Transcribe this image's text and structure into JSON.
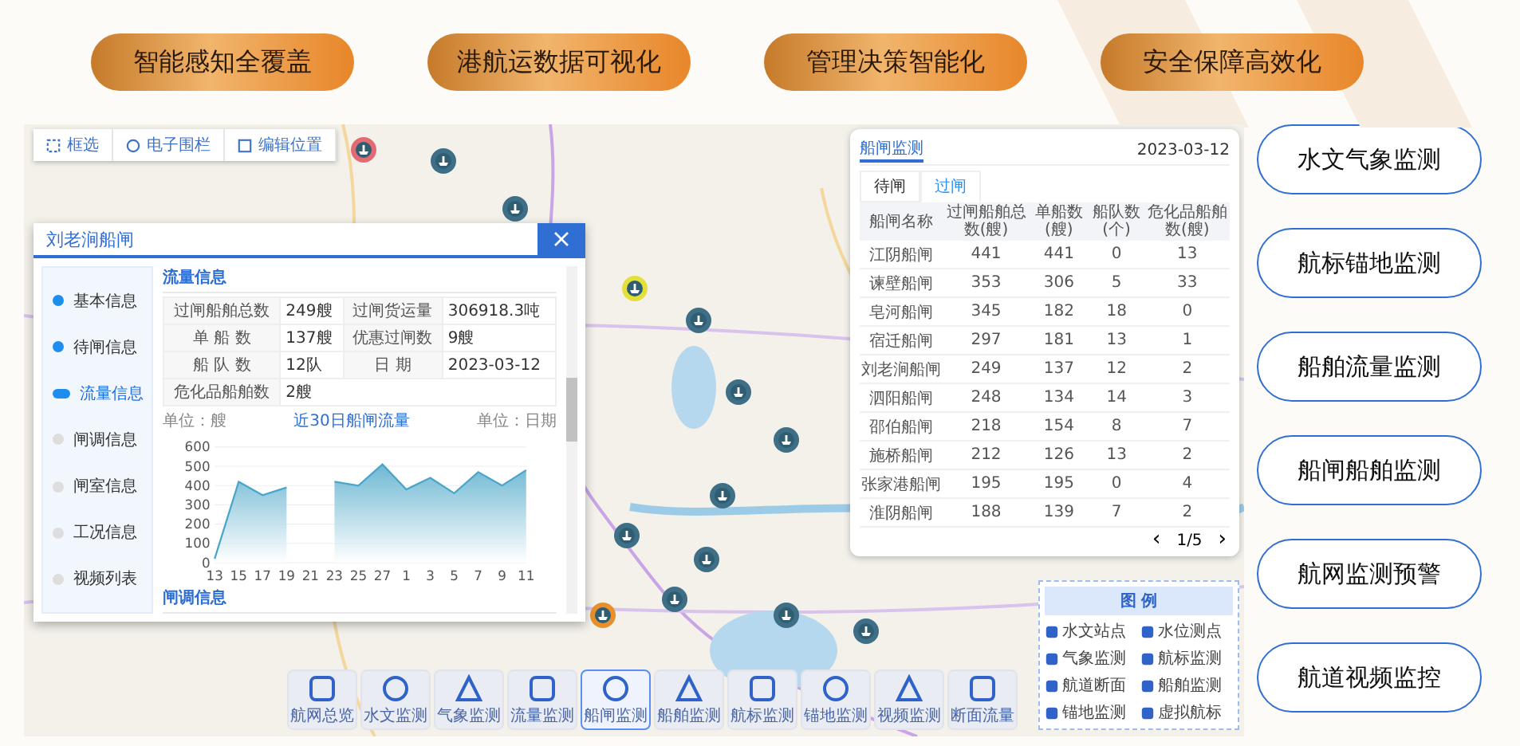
{
  "banner_pills": [
    "智能感知全覆盖",
    "港航运数据可视化",
    "管理决策智能化",
    "安全保障高效化"
  ],
  "map": {
    "tools": [
      "框选",
      "电子围栏",
      "编辑位置"
    ],
    "lock_popup": {
      "title": "刘老涧船闸",
      "steps": [
        {
          "label": "基本信息",
          "done": true,
          "selected": false
        },
        {
          "label": "待闸信息",
          "done": true,
          "selected": false
        },
        {
          "label": "流量信息",
          "done": true,
          "selected": true
        },
        {
          "label": "闸调信息",
          "done": false,
          "selected": false
        },
        {
          "label": "闸室信息",
          "done": false,
          "selected": false
        },
        {
          "label": "工况信息",
          "done": false,
          "selected": false
        },
        {
          "label": "视频列表",
          "done": false,
          "selected": false
        }
      ],
      "section_title": "流量信息",
      "info": [
        [
          {
            "label": "过闸船舶总数",
            "value": "249艘"
          },
          {
            "label": "过闸货运量",
            "value": "306918.3吨"
          }
        ],
        [
          {
            "label": "单 船 数",
            "value": "137艘"
          },
          {
            "label": "优惠过闸数",
            "value": "9艘"
          }
        ],
        [
          {
            "label": "船 队 数",
            "value": "12队"
          },
          {
            "label": "日 期",
            "value": "2023-03-12"
          }
        ],
        [
          {
            "label": "危化品船舶数",
            "value": "2艘"
          }
        ]
      ],
      "flow_chart": {
        "unit_left": "单位：艘",
        "unit_right": "单位：日期",
        "chart_data": {
          "type": "area",
          "title": "近30日船闸流量",
          "categories": [
            "13",
            "15",
            "17",
            "19",
            "21",
            "23",
            "25",
            "27",
            "1",
            "3",
            "5",
            "7",
            "9",
            "11"
          ],
          "series": [
            {
              "color": "#4aa6c8",
              "values": [
                20,
                420,
                350,
                390,
                null,
                420,
                400,
                510,
                380,
                440,
                360,
                470,
                400,
                480
              ]
            }
          ],
          "ylim": [
            0,
            600
          ],
          "yticks": [
            0,
            100,
            200,
            300,
            400,
            500,
            600
          ],
          "grid": true
        }
      },
      "next_section_title": "闸调信息"
    },
    "monitor_panel": {
      "title": "船闸监测",
      "date": "2023-03-12",
      "tabs": [
        {
          "label": "待闸",
          "selected": false
        },
        {
          "label": "过闸",
          "selected": true
        }
      ],
      "columns": [
        "船闸名称",
        "过闸船舶总数(艘)",
        "单船数(艘)",
        "船队数(个)",
        "危化品船舶数(艘)"
      ],
      "rows": [
        [
          "江阴船闸",
          "441",
          "441",
          "0",
          "13"
        ],
        [
          "谏壁船闸",
          "353",
          "306",
          "5",
          "33"
        ],
        [
          "皂河船闸",
          "345",
          "182",
          "18",
          "0"
        ],
        [
          "宿迁船闸",
          "297",
          "181",
          "13",
          "1"
        ],
        [
          "刘老涧船闸",
          "249",
          "137",
          "12",
          "2"
        ],
        [
          "泗阳船闸",
          "248",
          "134",
          "14",
          "3"
        ],
        [
          "邵伯船闸",
          "218",
          "154",
          "8",
          "7"
        ],
        [
          "施桥船闸",
          "212",
          "126",
          "13",
          "2"
        ],
        [
          "张家港船闸",
          "195",
          "195",
          "0",
          "4"
        ],
        [
          "淮阴船闸",
          "188",
          "139",
          "7",
          "2"
        ]
      ],
      "pager": {
        "prev": "‹",
        "page": "1/5",
        "next": "›"
      }
    },
    "toolbar": [
      {
        "label": "航网总览",
        "selected": false
      },
      {
        "label": "水文监测",
        "selected": false
      },
      {
        "label": "气象监测",
        "selected": false
      },
      {
        "label": "流量监测",
        "selected": false
      },
      {
        "label": "船闸监测",
        "selected": true
      },
      {
        "label": "船舶监测",
        "selected": false
      },
      {
        "label": "航标监测",
        "selected": false
      },
      {
        "label": "锚地监测",
        "selected": false
      },
      {
        "label": "视频监测",
        "selected": false
      },
      {
        "label": "断面流量",
        "selected": false
      }
    ],
    "legend": {
      "title": "图 例",
      "items": [
        "水文站点",
        "水位测点",
        "气象监测",
        "航标监测",
        "航道断面",
        "船舶监测",
        "锚地监测",
        "虚拟航标"
      ]
    }
  },
  "side_buttons": [
    "水文气象监测",
    "航标锚地监测",
    "船舶流量监测",
    "船闸船舶监测",
    "航网监测预警",
    "航道视频监控"
  ]
}
